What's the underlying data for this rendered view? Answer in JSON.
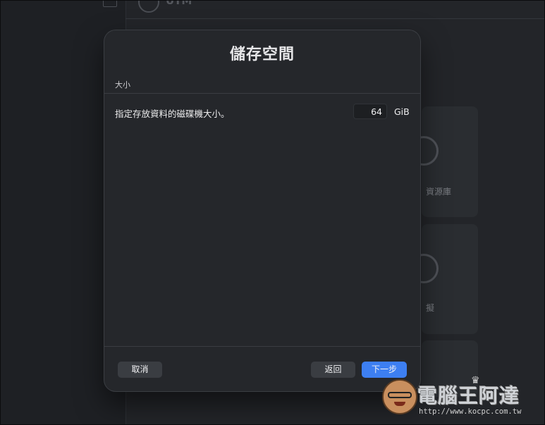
{
  "background": {
    "app_title": "UTM",
    "cards": [
      {
        "label": "資源庫"
      },
      {
        "label": "擬"
      },
      {
        "label": ""
      }
    ]
  },
  "dialog": {
    "title": "儲存空間",
    "section_label": "大小",
    "size_row": {
      "label": "指定存放資料的磁碟機大小。",
      "value": "64",
      "unit": "GiB"
    },
    "buttons": {
      "cancel": "取消",
      "back": "返回",
      "next": "下一步"
    }
  },
  "watermark": {
    "name": "電腦王阿達",
    "url": "http://www.kocpc.com.tw",
    "crown_icon": "crown-icon"
  },
  "colors": {
    "accent": "#3d7ff2",
    "dialog_bg": "#25272b",
    "page_bg": "#1f2125"
  }
}
